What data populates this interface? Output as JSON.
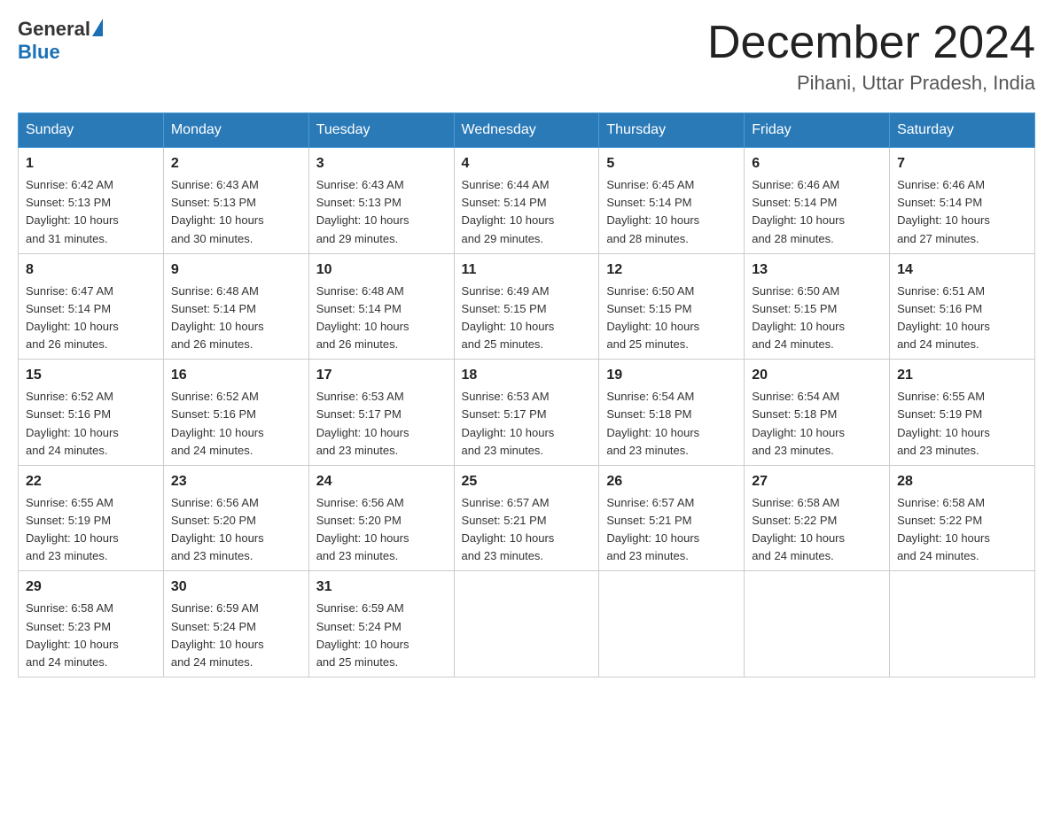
{
  "header": {
    "logo": {
      "general": "General",
      "blue": "Blue"
    },
    "title": "December 2024",
    "location": "Pihani, Uttar Pradesh, India"
  },
  "weekdays": [
    "Sunday",
    "Monday",
    "Tuesday",
    "Wednesday",
    "Thursday",
    "Friday",
    "Saturday"
  ],
  "weeks": [
    [
      {
        "day": "1",
        "sunrise": "6:42 AM",
        "sunset": "5:13 PM",
        "daylight": "10 hours and 31 minutes."
      },
      {
        "day": "2",
        "sunrise": "6:43 AM",
        "sunset": "5:13 PM",
        "daylight": "10 hours and 30 minutes."
      },
      {
        "day": "3",
        "sunrise": "6:43 AM",
        "sunset": "5:13 PM",
        "daylight": "10 hours and 29 minutes."
      },
      {
        "day": "4",
        "sunrise": "6:44 AM",
        "sunset": "5:14 PM",
        "daylight": "10 hours and 29 minutes."
      },
      {
        "day": "5",
        "sunrise": "6:45 AM",
        "sunset": "5:14 PM",
        "daylight": "10 hours and 28 minutes."
      },
      {
        "day": "6",
        "sunrise": "6:46 AM",
        "sunset": "5:14 PM",
        "daylight": "10 hours and 28 minutes."
      },
      {
        "day": "7",
        "sunrise": "6:46 AM",
        "sunset": "5:14 PM",
        "daylight": "10 hours and 27 minutes."
      }
    ],
    [
      {
        "day": "8",
        "sunrise": "6:47 AM",
        "sunset": "5:14 PM",
        "daylight": "10 hours and 26 minutes."
      },
      {
        "day": "9",
        "sunrise": "6:48 AM",
        "sunset": "5:14 PM",
        "daylight": "10 hours and 26 minutes."
      },
      {
        "day": "10",
        "sunrise": "6:48 AM",
        "sunset": "5:14 PM",
        "daylight": "10 hours and 26 minutes."
      },
      {
        "day": "11",
        "sunrise": "6:49 AM",
        "sunset": "5:15 PM",
        "daylight": "10 hours and 25 minutes."
      },
      {
        "day": "12",
        "sunrise": "6:50 AM",
        "sunset": "5:15 PM",
        "daylight": "10 hours and 25 minutes."
      },
      {
        "day": "13",
        "sunrise": "6:50 AM",
        "sunset": "5:15 PM",
        "daylight": "10 hours and 24 minutes."
      },
      {
        "day": "14",
        "sunrise": "6:51 AM",
        "sunset": "5:16 PM",
        "daylight": "10 hours and 24 minutes."
      }
    ],
    [
      {
        "day": "15",
        "sunrise": "6:52 AM",
        "sunset": "5:16 PM",
        "daylight": "10 hours and 24 minutes."
      },
      {
        "day": "16",
        "sunrise": "6:52 AM",
        "sunset": "5:16 PM",
        "daylight": "10 hours and 24 minutes."
      },
      {
        "day": "17",
        "sunrise": "6:53 AM",
        "sunset": "5:17 PM",
        "daylight": "10 hours and 23 minutes."
      },
      {
        "day": "18",
        "sunrise": "6:53 AM",
        "sunset": "5:17 PM",
        "daylight": "10 hours and 23 minutes."
      },
      {
        "day": "19",
        "sunrise": "6:54 AM",
        "sunset": "5:18 PM",
        "daylight": "10 hours and 23 minutes."
      },
      {
        "day": "20",
        "sunrise": "6:54 AM",
        "sunset": "5:18 PM",
        "daylight": "10 hours and 23 minutes."
      },
      {
        "day": "21",
        "sunrise": "6:55 AM",
        "sunset": "5:19 PM",
        "daylight": "10 hours and 23 minutes."
      }
    ],
    [
      {
        "day": "22",
        "sunrise": "6:55 AM",
        "sunset": "5:19 PM",
        "daylight": "10 hours and 23 minutes."
      },
      {
        "day": "23",
        "sunrise": "6:56 AM",
        "sunset": "5:20 PM",
        "daylight": "10 hours and 23 minutes."
      },
      {
        "day": "24",
        "sunrise": "6:56 AM",
        "sunset": "5:20 PM",
        "daylight": "10 hours and 23 minutes."
      },
      {
        "day": "25",
        "sunrise": "6:57 AM",
        "sunset": "5:21 PM",
        "daylight": "10 hours and 23 minutes."
      },
      {
        "day": "26",
        "sunrise": "6:57 AM",
        "sunset": "5:21 PM",
        "daylight": "10 hours and 23 minutes."
      },
      {
        "day": "27",
        "sunrise": "6:58 AM",
        "sunset": "5:22 PM",
        "daylight": "10 hours and 24 minutes."
      },
      {
        "day": "28",
        "sunrise": "6:58 AM",
        "sunset": "5:22 PM",
        "daylight": "10 hours and 24 minutes."
      }
    ],
    [
      {
        "day": "29",
        "sunrise": "6:58 AM",
        "sunset": "5:23 PM",
        "daylight": "10 hours and 24 minutes."
      },
      {
        "day": "30",
        "sunrise": "6:59 AM",
        "sunset": "5:24 PM",
        "daylight": "10 hours and 24 minutes."
      },
      {
        "day": "31",
        "sunrise": "6:59 AM",
        "sunset": "5:24 PM",
        "daylight": "10 hours and 25 minutes."
      },
      null,
      null,
      null,
      null
    ]
  ],
  "labels": {
    "sunrise": "Sunrise:",
    "sunset": "Sunset:",
    "daylight": "Daylight:"
  }
}
